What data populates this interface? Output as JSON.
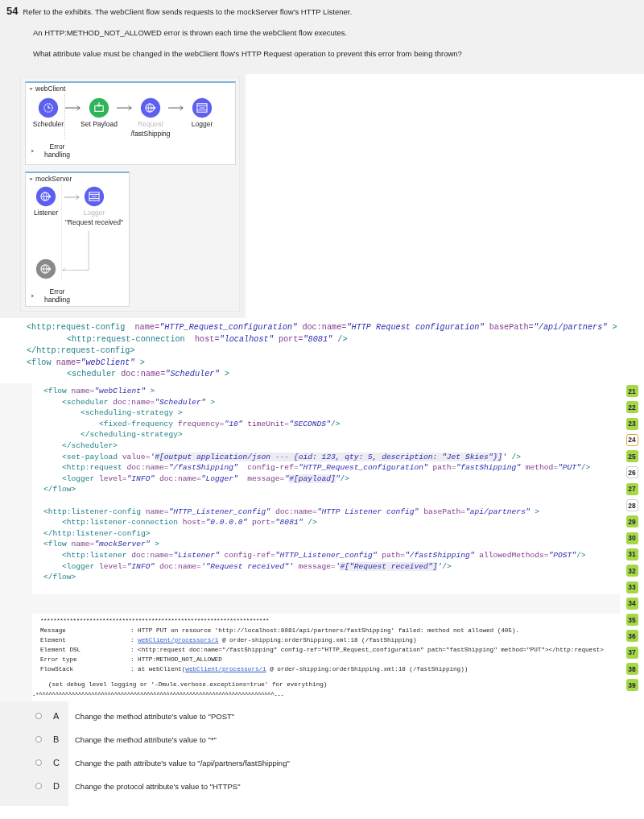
{
  "question": {
    "number": "54",
    "paragraphs": [
      "Refer to the exhibits. The webClient flow sends requests to the mockServer flow's HTTP Listener.",
      "An HTTP:METHOD_NOT_ALLOWED error is thrown each time the webClient flow executes.",
      "What attribute value must be changed in the webClient flow's HTTP Request operation to prevent this error from being thrown?"
    ]
  },
  "diagram": {
    "flows": [
      {
        "name": "webClient",
        "expanded": true,
        "error_handling": {
          "label": "Error handling",
          "expanded": false
        },
        "nodes": [
          {
            "kind": "scheduler",
            "label": "Scheduler",
            "dimmed": false,
            "color": "#5d5ff0"
          },
          {
            "kind": "payload",
            "label": "Set Payload",
            "dimmed": false,
            "color": "#2fb45a"
          },
          {
            "kind": "request",
            "label": "Request",
            "caption": "/fastShipping",
            "dimmed": true,
            "color": "#5d5ff0"
          },
          {
            "kind": "logger",
            "label": "Logger",
            "dimmed": false,
            "color": "#5d5ff0"
          }
        ]
      },
      {
        "name": "mockServer",
        "expanded": true,
        "error_handling": {
          "label": "Error handling",
          "expanded": false
        },
        "nodes": [
          {
            "kind": "listener",
            "label": "Listener",
            "dimmed": false,
            "color": "#5d5ff0"
          },
          {
            "kind": "logger",
            "label": "Logger",
            "caption": "\"Request received\"",
            "dimmed": true,
            "color": "#5d5ff0"
          },
          {
            "kind": "error",
            "color": "#8a8a8a"
          }
        ]
      }
    ]
  },
  "config_code": [
    {
      "tokens": [
        {
          "kind": "tag",
          "text": "<http:request-config  "
        },
        {
          "kind": "attr",
          "text": "name="
        },
        {
          "kind": "str",
          "text": "\"HTTP_Request_configuration\""
        },
        {
          "kind": "attr",
          "text": " doc:name="
        },
        {
          "kind": "str",
          "text": "\"HTTP Request configuration\""
        },
        {
          "kind": "attr",
          "text": " basePath="
        },
        {
          "kind": "str",
          "text": "\"/api/partners\""
        },
        {
          "kind": "tag",
          "text": " >"
        }
      ],
      "children": [
        {
          "tokens": [
            {
              "kind": "tag",
              "text": "<http:request-connection  "
            },
            {
              "kind": "attr",
              "text": "host="
            },
            {
              "kind": "str",
              "text": "\"localhost\""
            },
            {
              "kind": "attr",
              "text": " port="
            },
            {
              "kind": "str",
              "text": "\"8081\""
            },
            {
              "kind": "tag",
              "text": " />"
            }
          ]
        }
      ]
    },
    {
      "tokens": [
        {
          "kind": "tag",
          "text": "</http:request-config>"
        }
      ]
    },
    {
      "tokens": [
        {
          "kind": "tag",
          "text": "<flow "
        },
        {
          "kind": "attr",
          "text": "name="
        },
        {
          "kind": "str",
          "text": "\"webClient\""
        },
        {
          "kind": "tag",
          "text": " >"
        }
      ],
      "children": [
        {
          "tokens": [
            {
              "kind": "tag",
              "text": "<scheduler "
            },
            {
              "kind": "attr",
              "text": "doc:name="
            },
            {
              "kind": "str",
              "text": "\"Scheduler\""
            },
            {
              "kind": "tag",
              "text": " >"
            }
          ]
        }
      ]
    }
  ],
  "flow_code": [
    [
      {
        "tokens": [
          {
            "kind": "tag",
            "text": "<flow "
          },
          {
            "kind": "attr",
            "text": "name="
          },
          {
            "kind": "str",
            "text": "\"webClient\""
          },
          {
            "kind": "tag",
            "text": " >"
          }
        ],
        "children": [
          {
            "tokens": [
              {
                "kind": "tag",
                "text": "<scheduler "
              },
              {
                "kind": "attr",
                "text": "doc:name="
              },
              {
                "kind": "str",
                "text": "\"Scheduler\""
              },
              {
                "kind": "tag",
                "text": " >"
              }
            ],
            "children": [
              {
                "tokens": [
                  {
                    "kind": "tag",
                    "text": "<scheduling-strategy >"
                  }
                ],
                "children": [
                  {
                    "tokens": [
                      {
                        "kind": "tag",
                        "text": "<fixed-frequency "
                      },
                      {
                        "kind": "attr",
                        "text": "frequency="
                      },
                      {
                        "kind": "str",
                        "text": "\"10\""
                      },
                      {
                        "kind": "attr",
                        "text": " timeUnit="
                      },
                      {
                        "kind": "str",
                        "text": "\"SECONDS\""
                      },
                      {
                        "kind": "tag",
                        "text": "/>"
                      }
                    ]
                  }
                ]
              },
              {
                "tokens": [
                  {
                    "kind": "tag",
                    "text": "</scheduling-strategy>"
                  }
                ]
              }
            ]
          },
          {
            "tokens": [
              {
                "kind": "tag",
                "text": "</scheduler>"
              }
            ]
          },
          {
            "tokens": [
              {
                "kind": "tag",
                "text": "<set-payload "
              },
              {
                "kind": "attr",
                "text": "value="
              },
              {
                "kind": "str",
                "text": "'"
              },
              {
                "kind": "expr",
                "text": "#[output application/json --- {oid: 123, qty: 5, description: \"Jet Skies\"}]"
              },
              {
                "kind": "str",
                "text": "'"
              },
              {
                "kind": "tag",
                "text": " />"
              }
            ]
          },
          {
            "tokens": [
              {
                "kind": "tag",
                "text": "<http:request "
              },
              {
                "kind": "attr",
                "text": "doc:name="
              },
              {
                "kind": "str",
                "text": "\"/fastShipping\""
              },
              {
                "kind": "attr",
                "text": "  config-ref="
              },
              {
                "kind": "str",
                "text": "\"HTTP_Request_configuration\""
              },
              {
                "kind": "attr",
                "text": " path="
              },
              {
                "kind": "str",
                "text": "\"fastShipping\""
              },
              {
                "kind": "attr",
                "text": " method="
              },
              {
                "kind": "str",
                "text": "\"PUT\""
              },
              {
                "kind": "tag",
                "text": "/>"
              }
            ]
          },
          {
            "tokens": [
              {
                "kind": "tag",
                "text": "<logger "
              },
              {
                "kind": "attr",
                "text": "level="
              },
              {
                "kind": "str",
                "text": "\"INFO\""
              },
              {
                "kind": "attr",
                "text": " doc:name="
              },
              {
                "kind": "str",
                "text": "\"Logger\""
              },
              {
                "kind": "attr",
                "text": "  message="
              },
              {
                "kind": "str",
                "text": "\""
              },
              {
                "kind": "expr",
                "text": "#[payload]"
              },
              {
                "kind": "str",
                "text": "\""
              },
              {
                "kind": "tag",
                "text": "/>"
              }
            ]
          }
        ]
      },
      {
        "tokens": [
          {
            "kind": "tag",
            "text": "</flow>"
          }
        ]
      }
    ],
    [
      {
        "tokens": [
          {
            "kind": "tag",
            "text": "<http:listener-config "
          },
          {
            "kind": "attr",
            "text": "name="
          },
          {
            "kind": "str",
            "text": "\"HTTP_Listener_config\""
          },
          {
            "kind": "attr",
            "text": " doc:name="
          },
          {
            "kind": "str",
            "text": "\"HTTP Listener config\""
          },
          {
            "kind": "attr",
            "text": " basePath="
          },
          {
            "kind": "str",
            "text": "\"api/partners\""
          },
          {
            "kind": "tag",
            "text": " >"
          }
        ],
        "children": [
          {
            "tokens": [
              {
                "kind": "tag",
                "text": "<http:listener-connection "
              },
              {
                "kind": "attr",
                "text": "host="
              },
              {
                "kind": "str",
                "text": "\"0.0.0.0\""
              },
              {
                "kind": "attr",
                "text": " port="
              },
              {
                "kind": "str",
                "text": "\"8081\""
              },
              {
                "kind": "tag",
                "text": " />"
              }
            ]
          }
        ]
      },
      {
        "tokens": [
          {
            "kind": "tag",
            "text": "</http:listener-config>"
          }
        ]
      },
      {
        "tokens": [
          {
            "kind": "tag",
            "text": "<flow "
          },
          {
            "kind": "attr",
            "text": "name="
          },
          {
            "kind": "str",
            "text": "\"mockServer\""
          },
          {
            "kind": "tag",
            "text": " >"
          }
        ],
        "children": [
          {
            "tokens": [
              {
                "kind": "tag",
                "text": "<http:listener "
              },
              {
                "kind": "attr",
                "text": "doc:name="
              },
              {
                "kind": "str",
                "text": "\"Listener\""
              },
              {
                "kind": "attr",
                "text": " config-ref="
              },
              {
                "kind": "str",
                "text": "\"HTTP_Listener_config\""
              },
              {
                "kind": "attr",
                "text": " path="
              },
              {
                "kind": "str",
                "text": "\"/fastShipping\""
              },
              {
                "kind": "attr",
                "text": " allowedMethods="
              },
              {
                "kind": "str",
                "text": "\"POST\""
              },
              {
                "kind": "tag",
                "text": "/>"
              }
            ]
          },
          {
            "tokens": [
              {
                "kind": "tag",
                "text": "<logger "
              },
              {
                "kind": "attr",
                "text": "level="
              },
              {
                "kind": "str",
                "text": "\"INFO\""
              },
              {
                "kind": "attr",
                "text": " doc:name="
              },
              {
                "kind": "str",
                "text": "'\"Request received\"'"
              },
              {
                "kind": "attr",
                "text": " message="
              },
              {
                "kind": "str",
                "text": "'"
              },
              {
                "kind": "expr",
                "text": "#[\"Request received\"]"
              },
              {
                "kind": "str",
                "text": "'"
              },
              {
                "kind": "tag",
                "text": "/>"
              }
            ]
          }
        ]
      },
      {
        "tokens": [
          {
            "kind": "tag",
            "text": "</flow>"
          }
        ]
      }
    ]
  ],
  "line_numbers": [
    {
      "number": "21",
      "kind": "green"
    },
    {
      "number": "22",
      "kind": "green"
    },
    {
      "number": "23",
      "kind": "green"
    },
    {
      "number": "24",
      "kind": "current"
    },
    {
      "number": "25",
      "kind": "green"
    },
    {
      "number": "26",
      "kind": "plain"
    },
    {
      "number": "27",
      "kind": "green"
    },
    {
      "number": "28",
      "kind": "plain"
    },
    {
      "number": "29",
      "kind": "green"
    },
    {
      "number": "30",
      "kind": "green"
    },
    {
      "number": "31",
      "kind": "green"
    },
    {
      "number": "32",
      "kind": "green"
    },
    {
      "number": "33",
      "kind": "green"
    },
    {
      "number": "34",
      "kind": "green"
    },
    {
      "number": "35",
      "kind": "green"
    },
    {
      "number": "36",
      "kind": "green"
    },
    {
      "number": "37",
      "kind": "green"
    },
    {
      "number": "38",
      "kind": "green"
    },
    {
      "number": "39",
      "kind": "green"
    }
  ],
  "error_log": {
    "header": "**********************************************************************",
    "rows": [
      {
        "label": "Message",
        "parts": [
          {
            "text": ": HTTP PUT on resource 'http://localhost:8081/api/partners/fastShipping' failed: method not allowed (405).",
            "link": false
          }
        ]
      },
      {
        "label": "Element",
        "parts": [
          {
            "text": ": ",
            "link": false
          },
          {
            "text": "webClient/processors/1",
            "link": true
          },
          {
            "text": " @ order-shipping:orderShipping.xml:18 (/fastShipping)",
            "link": false
          }
        ]
      },
      {
        "label": "Element DSL",
        "parts": [
          {
            "text": ": <http:request doc:name=\"/fastShipping\" config-ref=\"HTTP_Request_configuration\" path=\"fastShipping\" method=\"PUT\"></http:request>",
            "link": false
          }
        ]
      },
      {
        "label": "Error type",
        "parts": [
          {
            "text": ": HTTP:METHOD_NOT_ALLOWED",
            "link": false
          }
        ]
      },
      {
        "label": "FlowStack",
        "parts": [
          {
            "text": ": at webClient(",
            "link": false
          },
          {
            "text": "webClient/processors/1",
            "link": true
          },
          {
            "text": " @ order-shipping:orderShipping.xml:18 (/fastShipping))",
            "link": false
          }
        ]
      }
    ],
    "note": "(set debug level logging or '-Dmule.verbose.exceptions=true' for everything)",
    "footer": "-*^^^^^^^^^^^^^^^^^^^^^^^^^^^^^^^^^^^^^^^^^^^^^^^^^^^^^^^^^^^^^^^^^^^^^^^^---"
  },
  "options": [
    {
      "letter": "A",
      "text": "Change the method attribute's value to \"POST\"",
      "selected": false
    },
    {
      "letter": "B",
      "text": "Change the method attribute's value to \"*\"",
      "selected": false
    },
    {
      "letter": "C",
      "text": "Change the path attribute's value to \"/api/partners/fastShipping\"",
      "selected": false
    },
    {
      "letter": "D",
      "text": "Change the protocol attribute's value to \"HTTPS\"",
      "selected": false
    }
  ]
}
